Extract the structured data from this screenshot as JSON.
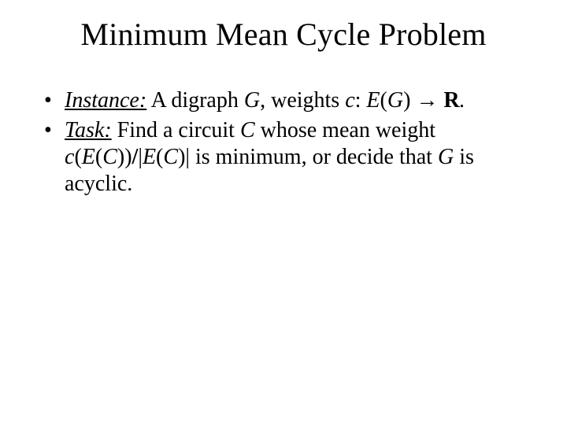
{
  "title": "Minimum Mean Cycle Problem",
  "bullets": {
    "b1": {
      "label_word": "Instance:",
      "t1": " A digraph ",
      "G": "G",
      "t2": ", weights ",
      "c": "c",
      "t3": ": ",
      "E": "E",
      "op": "(",
      "G2": "G",
      "cp": ") → ",
      "R": "R",
      "dot": "."
    },
    "b2": {
      "label_word": "Task:",
      "t1": " Find a circuit ",
      "C": "C",
      "t2": " whose mean weight ",
      "expr_c": "c",
      "expr_op1": "(",
      "expr_E1": "E",
      "expr_op2": "(",
      "expr_C1": "C",
      "expr_cp1": "))",
      "slash": "/",
      "bar1": "|",
      "expr_E2": "E",
      "expr_op3": "(",
      "expr_C2": "C",
      "expr_cp2": ")|",
      "t3": " is minimum, or decide that ",
      "G": "G",
      "t4": " is acyclic."
    }
  }
}
